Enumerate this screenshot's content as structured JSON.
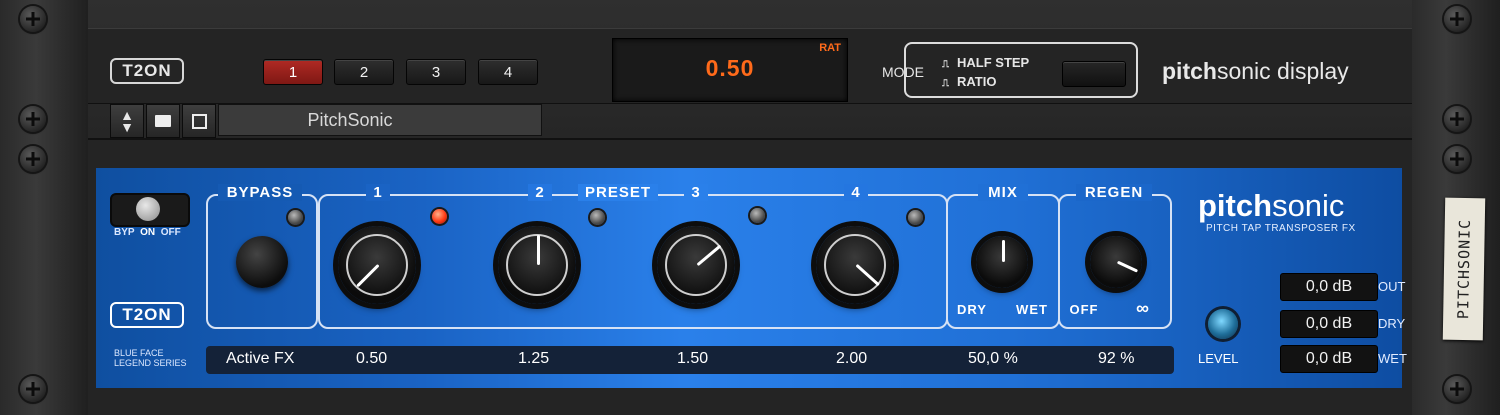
{
  "top": {
    "logo": "T2ON",
    "slots": [
      {
        "label": "1",
        "active": true
      },
      {
        "label": "2",
        "active": false
      },
      {
        "label": "3",
        "active": false
      },
      {
        "label": "4",
        "active": false
      }
    ],
    "display": {
      "value": "0.50",
      "tag": "RAT"
    },
    "mode": {
      "label": "MODE",
      "options": [
        "HALF STEP",
        "RATIO"
      ]
    },
    "brand": {
      "bold": "pitch",
      "rest": "sonic display"
    },
    "preset_name": "PitchSonic"
  },
  "main": {
    "bypass_switch_labels": {
      "byp": "BYP",
      "on": "ON",
      "off": "OFF"
    },
    "logo": "T2ON",
    "series": [
      "BLUE FACE",
      "LEGEND SERIES"
    ],
    "groups": {
      "bypass": "BYPASS",
      "preset": "PRESET",
      "tap_labels": [
        "1",
        "2",
        "3",
        "4"
      ],
      "mix": "MIX",
      "mix_min": "DRY",
      "mix_max": "WET",
      "regen": "REGEN",
      "regen_min": "OFF",
      "regen_max": "∞"
    },
    "readouts": [
      "Active FX",
      "0.50",
      "1.25",
      "1.50",
      "2.00",
      "50,0 %",
      "92 %"
    ],
    "brand": {
      "bold": "pitch",
      "rest": "sonic",
      "sub": "PITCH TAP TRANSPOSER FX"
    },
    "level_label": "LEVEL",
    "meters": [
      {
        "value": "0,0 dB",
        "label": "OUT"
      },
      {
        "value": "0,0 dB",
        "label": "DRY"
      },
      {
        "value": "0,0 dB",
        "label": "WET"
      }
    ],
    "tape_label": "PITCHSONIC"
  },
  "colors": {
    "accent_orange": "#ff6a1a",
    "panel_blue": "#1a63c4",
    "active_red": "#b02a24"
  }
}
